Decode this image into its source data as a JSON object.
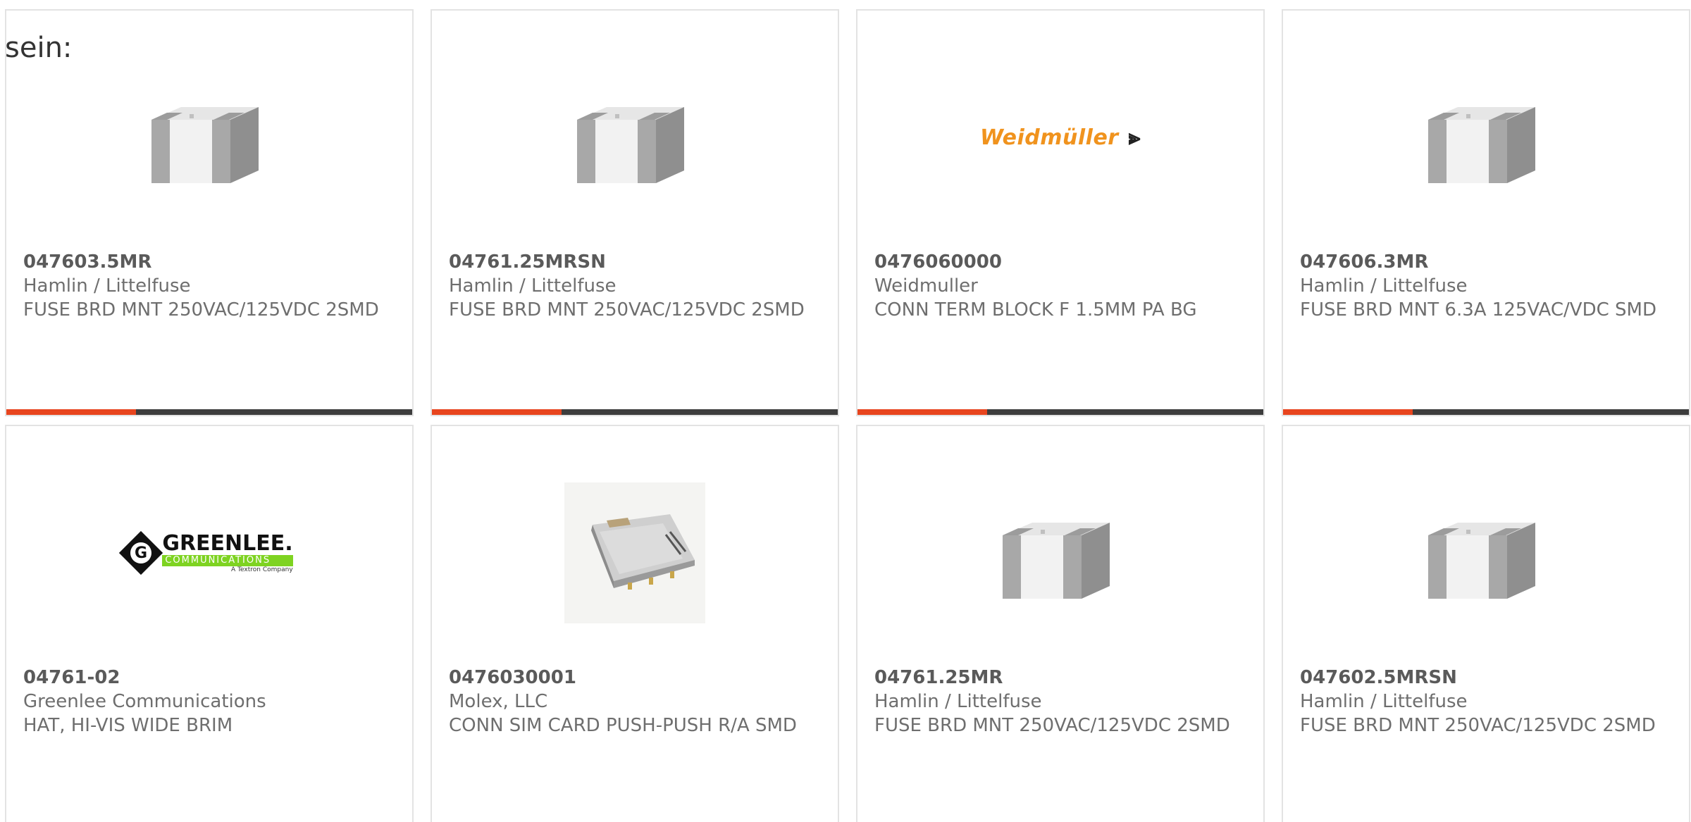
{
  "intro_text": "sein:",
  "products": [
    {
      "part_number": "047603.5MR",
      "manufacturer": "Hamlin / Littelfuse",
      "description": "FUSE BRD MNT 250VAC/125VDC 2SMD",
      "image": "fuse-image"
    },
    {
      "part_number": "04761.25MRSN",
      "manufacturer": "Hamlin / Littelfuse",
      "description": "FUSE BRD MNT 250VAC/125VDC 2SMD",
      "image": "fuse-image"
    },
    {
      "part_number": "0476060000",
      "manufacturer": "Weidmuller",
      "description": "CONN TERM BLOCK F 1.5MM PA BG",
      "image": "weidmuller-logo",
      "logo_text": "Weidmüller"
    },
    {
      "part_number": "047606.3MR",
      "manufacturer": "Hamlin / Littelfuse",
      "description": "FUSE BRD MNT 6.3A 125VAC/VDC SMD",
      "image": "fuse-image"
    },
    {
      "part_number": "04761-02",
      "manufacturer": "Greenlee Communications",
      "description": "HAT, HI-VIS WIDE BRIM",
      "image": "greenlee-logo",
      "logo_text": "GREENLEE.",
      "logo_sub": "COMMUNICATIONS",
      "logo_tag": "A Textron Company"
    },
    {
      "part_number": "0476030001",
      "manufacturer": "Molex, LLC",
      "description": "CONN SIM CARD PUSH-PUSH R/A SMD",
      "image": "sim-connector-image"
    },
    {
      "part_number": "04761.25MR",
      "manufacturer": "Hamlin / Littelfuse",
      "description": "FUSE BRD MNT 250VAC/125VDC 2SMD",
      "image": "fuse-image"
    },
    {
      "part_number": "047602.5MRSN",
      "manufacturer": "Hamlin / Littelfuse",
      "description": "FUSE BRD MNT 250VAC/125VDC 2SMD",
      "image": "fuse-image"
    }
  ],
  "colors": {
    "accent": "#e8451e",
    "bar": "#3d3d3d",
    "border": "#e3e3e3",
    "text": "#6e6e6e"
  },
  "progress_fraction": 0.32
}
